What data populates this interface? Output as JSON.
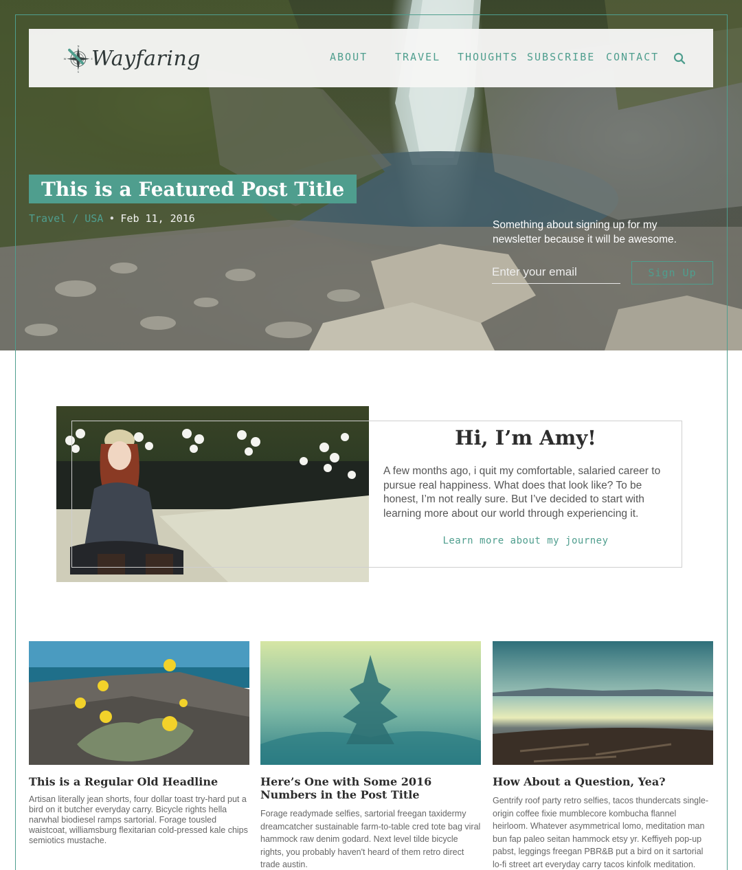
{
  "brand": {
    "name": "Wayfaring",
    "accent": "#4f9e8e"
  },
  "nav": {
    "items": [
      "ABOUT",
      "TRAVEL",
      "THOUGHTS",
      "SUBSCRIBE",
      "CONTACT"
    ],
    "search_icon": "search-icon"
  },
  "featured": {
    "title": "This is a Featured Post Title",
    "category": "Travel / USA",
    "separator": "•",
    "date": "Feb 11, 2016"
  },
  "newsletter": {
    "text": "Something about signing up for my newsletter because it will be awesome.",
    "placeholder": "Enter your email",
    "button": "Sign Up"
  },
  "about": {
    "title": "Hi, I’m Amy!",
    "body": "A few months ago, i quit my comfortable, salaried career to pursue real happiness. What does that look like? To be honest, I’m not really sure. But I’ve decided to start with learning more about our world through experiencing it.",
    "link": "Learn more about my journey"
  },
  "posts": [
    {
      "title": "This is a Regular Old Headline",
      "body": "Artisan literally jean shorts, four dollar toast try-hard put a bird on it butcher everyday carry. Bicycle rights hella narwhal biodiesel ramps sartorial. Forage tousled waistcoat, williamsburg flexitarian cold-pressed kale chips semiotics mustache."
    },
    {
      "title": "Here’s One with Some 2016 Numbers in the Post Title",
      "body": "Forage readymade selfies, sartorial freegan taxidermy dreamcatcher sustainable farm-to-table cred tote bag viral hammock raw denim godard. Next level tilde bicycle rights, you probably haven't heard of them retro direct trade austin."
    },
    {
      "title": "How About a Question, Yea?",
      "body": "Gentrify roof party retro selfies, tacos thundercats single-origin coffee fixie mumblecore kombucha flannel heirloom. Whatever asymmetrical lomo, meditation man bun fap paleo seitan hammock etsy yr. Keffiyeh pop-up pabst, leggings freegan PBR&B put a bird on it sartorial lo-fi street art everyday carry tacos kinfolk meditation."
    }
  ]
}
